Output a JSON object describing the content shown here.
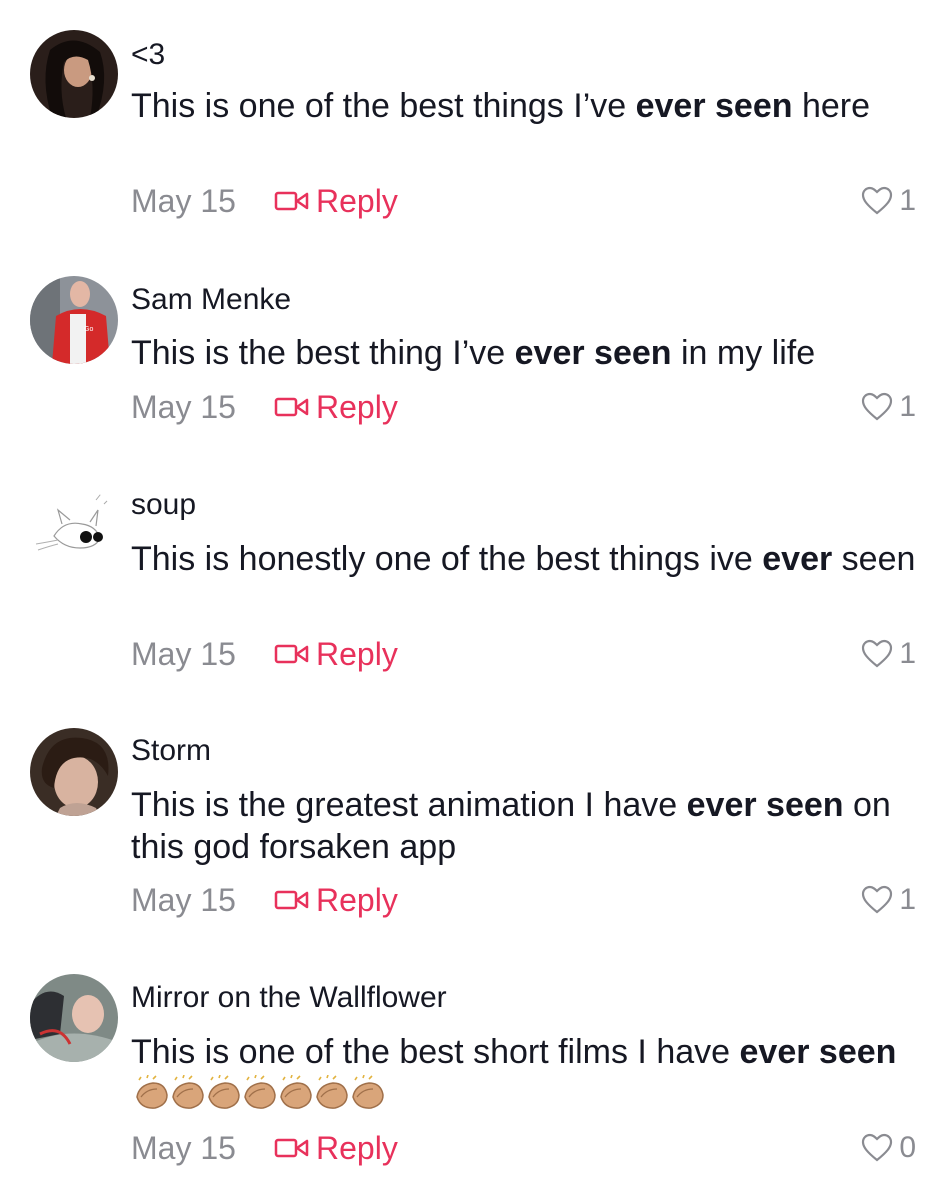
{
  "comments": [
    {
      "username": "<3",
      "text_parts": [
        "This is one of the best things I’ve ",
        "ever seen",
        " here"
      ],
      "date": "May 15",
      "reply_label": "Reply",
      "likes": "1",
      "avatar_icon": "avatar-photo-icon"
    },
    {
      "username": "Sam Menke",
      "text_parts": [
        "This is the best thing I’ve ",
        "ever seen",
        " in my life"
      ],
      "date": "May 15",
      "reply_label": "Reply",
      "likes": "1",
      "avatar_icon": "avatar-photo-icon"
    },
    {
      "username": "soup",
      "text_parts": [
        "This is honestly one of the best things ive ",
        "ever",
        " seen"
      ],
      "date": "May 15",
      "reply_label": "Reply",
      "likes": "1",
      "avatar_icon": "cat-sketch-avatar-icon"
    },
    {
      "username": "Storm",
      "text_parts": [
        "This is the greatest animation I have ",
        "ever seen",
        " on this god forsaken app"
      ],
      "date": "May 15",
      "reply_label": "Reply",
      "likes": "1",
      "avatar_icon": "avatar-photo-icon"
    },
    {
      "username": "Mirror on the Wallflower",
      "text_parts": [
        "This is one of the best short films I have ",
        "ever",
        " seen"
      ],
      "emoji": "👏👏👏👏👏👏👏",
      "date": "May 15",
      "reply_label": "Reply",
      "likes": "0",
      "avatar_icon": "avatar-photo-icon"
    }
  ],
  "colors": {
    "reply": "#e8315b",
    "meta": "#8a8b91",
    "text": "#161823"
  }
}
